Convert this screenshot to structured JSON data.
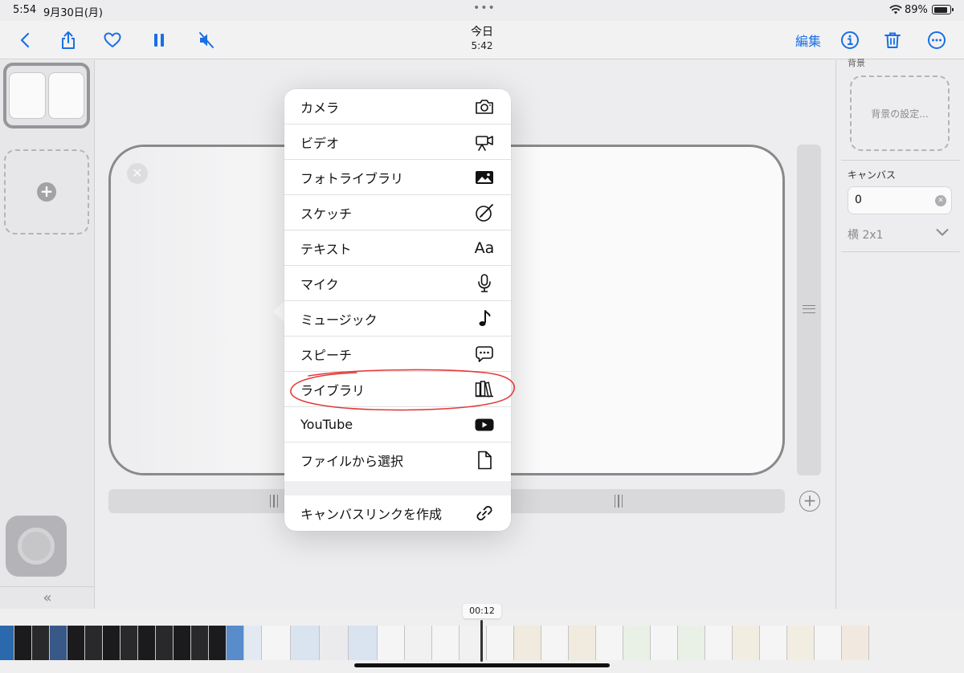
{
  "status": {
    "time": "5:54",
    "date": "9月30日(月)",
    "dots": "•••",
    "battery": "89%",
    "battery_level": 0.89
  },
  "toolbar": {
    "title": "今日",
    "subtitle": "5:42",
    "edit_label": "編集",
    "icons": [
      "back-icon",
      "share-icon",
      "heart-icon",
      "pause-icon",
      "mute-icon",
      "info-icon",
      "trash-icon",
      "more-icon"
    ]
  },
  "right_panel": {
    "background_label": "背景",
    "background_button": "背景の設定...",
    "canvas_label": "キャンバス",
    "canvas_value": "0",
    "layout_value": "横 2x1"
  },
  "menu": {
    "items": [
      {
        "label": "カメラ",
        "icon": "camera-icon"
      },
      {
        "label": "ビデオ",
        "icon": "video-camera-icon"
      },
      {
        "label": "フォトライブラリ",
        "icon": "photo-icon"
      },
      {
        "label": "スケッチ",
        "icon": "sketch-icon"
      },
      {
        "label": "テキスト",
        "icon": "text-icon",
        "glyph": "Aa"
      },
      {
        "label": "マイク",
        "icon": "microphone-icon"
      },
      {
        "label": "ミュージック",
        "icon": "music-note-icon"
      },
      {
        "label": "スピーチ",
        "icon": "speech-bubble-icon"
      },
      {
        "label": "ライブラリ",
        "icon": "library-icon",
        "highlighted": true
      },
      {
        "label": "YouTube",
        "icon": "youtube-icon"
      },
      {
        "label": "ファイルから選択",
        "icon": "document-icon"
      },
      {
        "label": "キャンバスリンクを作成",
        "icon": "link-icon"
      }
    ]
  },
  "timeline": {
    "current_time": "00:12"
  },
  "colors": {
    "accent": "#1a73e8",
    "annotation": "#e23b3b"
  }
}
